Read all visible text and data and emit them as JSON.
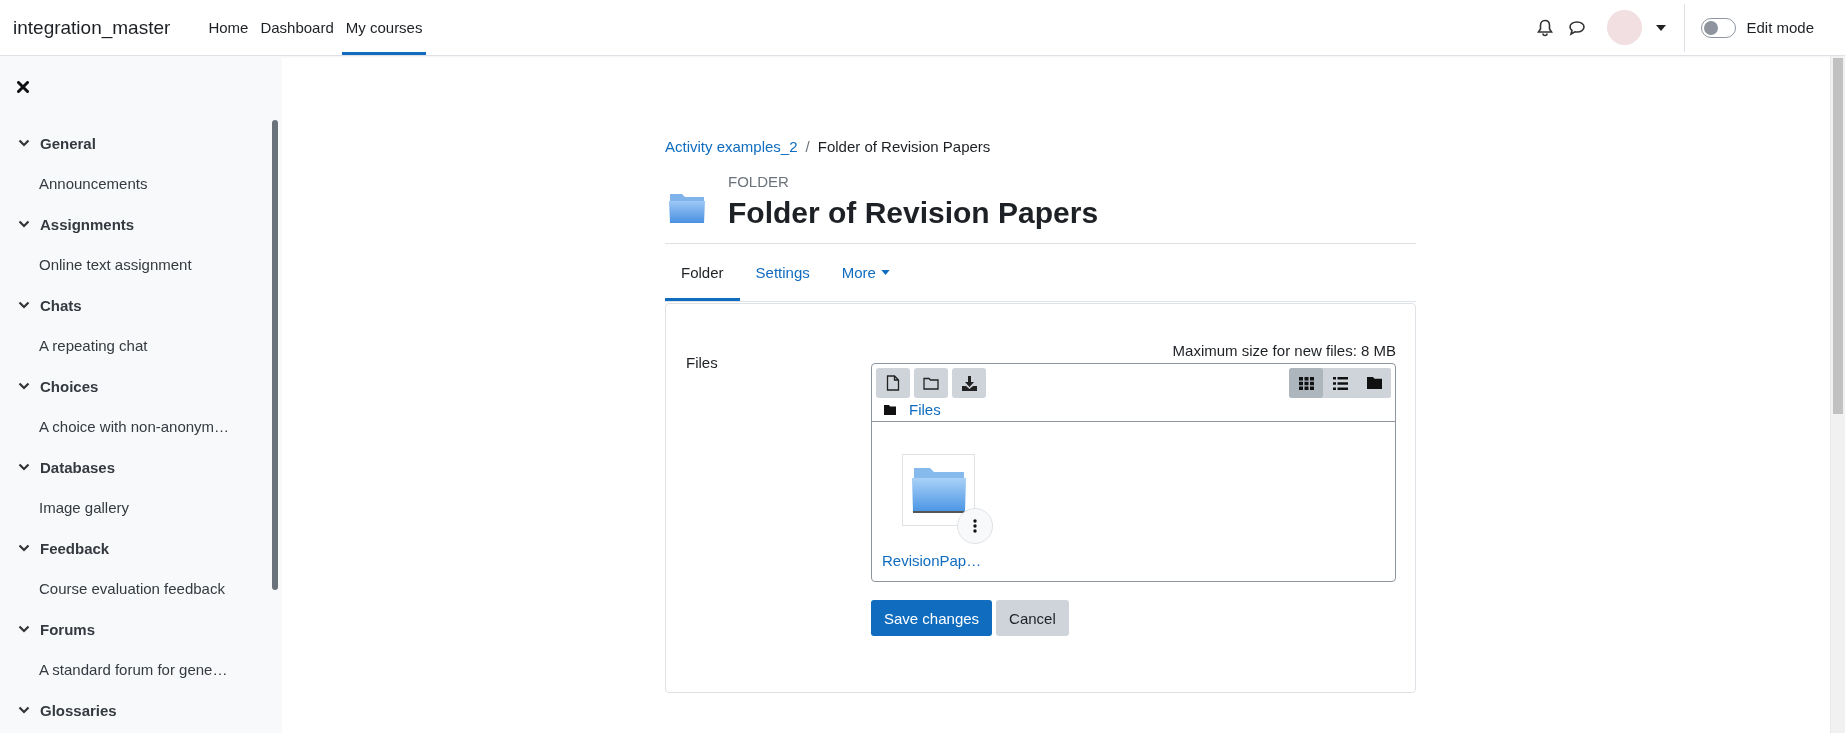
{
  "navbar": {
    "site_name": "integration_master",
    "links": [
      {
        "label": "Home",
        "selected": false
      },
      {
        "label": "Dashboard",
        "selected": false
      },
      {
        "label": "My courses",
        "selected": true
      }
    ],
    "edit_mode": {
      "label": "Edit mode",
      "on": false
    }
  },
  "course_index": {
    "sections": [
      {
        "title": "General",
        "expanded": true,
        "children": [
          {
            "label": "Announcements"
          }
        ]
      },
      {
        "title": "Assignments",
        "expanded": true,
        "children": [
          {
            "label": "Online text assignment"
          }
        ]
      },
      {
        "title": "Chats",
        "expanded": true,
        "children": [
          {
            "label": "A repeating chat"
          }
        ]
      },
      {
        "title": "Choices",
        "expanded": true,
        "children": [
          {
            "label": "A choice with non-anonym…"
          }
        ]
      },
      {
        "title": "Databases",
        "expanded": true,
        "children": [
          {
            "label": "Image gallery"
          }
        ]
      },
      {
        "title": "Feedback",
        "expanded": true,
        "children": [
          {
            "label": "Course evaluation feedback"
          }
        ]
      },
      {
        "title": "Forums",
        "expanded": true,
        "children": [
          {
            "label": "A standard forum for gene…"
          }
        ]
      },
      {
        "title": "Glossaries",
        "expanded": true
      }
    ]
  },
  "breadcrumb": {
    "separator": "/",
    "items": [
      {
        "label": "Activity examples_2",
        "link": true
      },
      {
        "label": "Folder of Revision Papers",
        "link": false
      }
    ]
  },
  "page_header": {
    "type_label": "FOLDER",
    "title": "Folder of Revision Papers"
  },
  "tabs": [
    {
      "label": "Folder",
      "selected": true,
      "dropdown": false
    },
    {
      "label": "Settings",
      "selected": false,
      "dropdown": false
    },
    {
      "label": "More",
      "selected": false,
      "dropdown": true
    }
  ],
  "form": {
    "field_label": "Files",
    "max_size": "Maximum size for new files: 8 MB",
    "path": "Files",
    "view_modes": [
      {
        "kind": "grid",
        "selected": true
      },
      {
        "kind": "list",
        "selected": false
      },
      {
        "kind": "tree",
        "selected": false
      }
    ],
    "files": [
      {
        "name": "RevisionPap…",
        "kind": "folder"
      }
    ],
    "buttons": [
      {
        "label": "Save changes",
        "kind": "primary"
      },
      {
        "label": "Cancel",
        "kind": "secondary"
      }
    ]
  }
}
